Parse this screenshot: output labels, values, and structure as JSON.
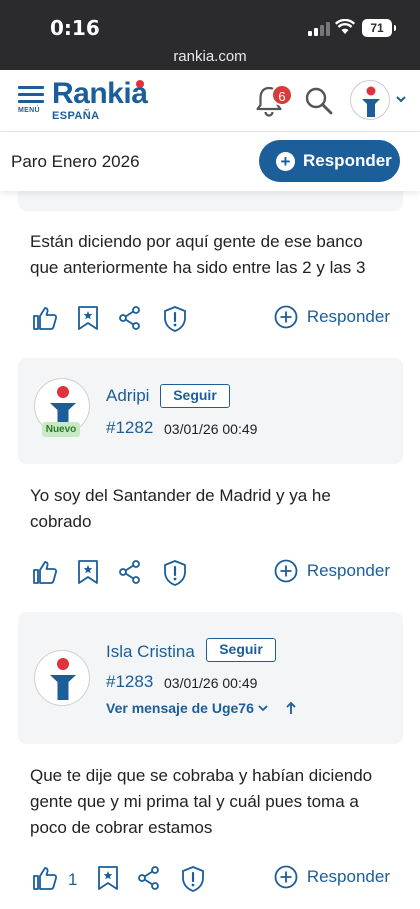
{
  "status_bar": {
    "time": "0:16",
    "battery": "71",
    "url": "rankia.com"
  },
  "header": {
    "menu_label": "MENÚ",
    "logo_text": "Rankia",
    "logo_country": "ESPAÑA",
    "notifications_count": "6"
  },
  "topic": {
    "title": "Paro Enero 2026",
    "reply_label": "Responder"
  },
  "posts": [
    {
      "message": "Están diciendo por aquí gente de ese banco que anteriormente ha sido entre las 2 y las 3",
      "reply_label": "Responder"
    },
    {
      "author": "Adripi",
      "follow_label": "Seguir",
      "badge": "Nuevo",
      "number": "#1282",
      "date": "03/01/26 00:49",
      "message": "Yo soy del Santander de Madrid y ya he cobrado",
      "reply_label": "Responder"
    },
    {
      "author": "Isla Cristina",
      "follow_label": "Seguir",
      "number": "#1283",
      "date": "03/01/26 00:49",
      "quote_link": "Ver mensaje de Uge76",
      "message": "Que te dije que se cobraba y habían diciendo gente que y mi prima tal y cuál pues toma a poco de cobrar estamos",
      "likes": "1",
      "reply_label": "Responder"
    }
  ],
  "colors": {
    "brand": "#1b5e9a",
    "accent": "#e0323c",
    "badge_green": "#c7e9c4"
  }
}
